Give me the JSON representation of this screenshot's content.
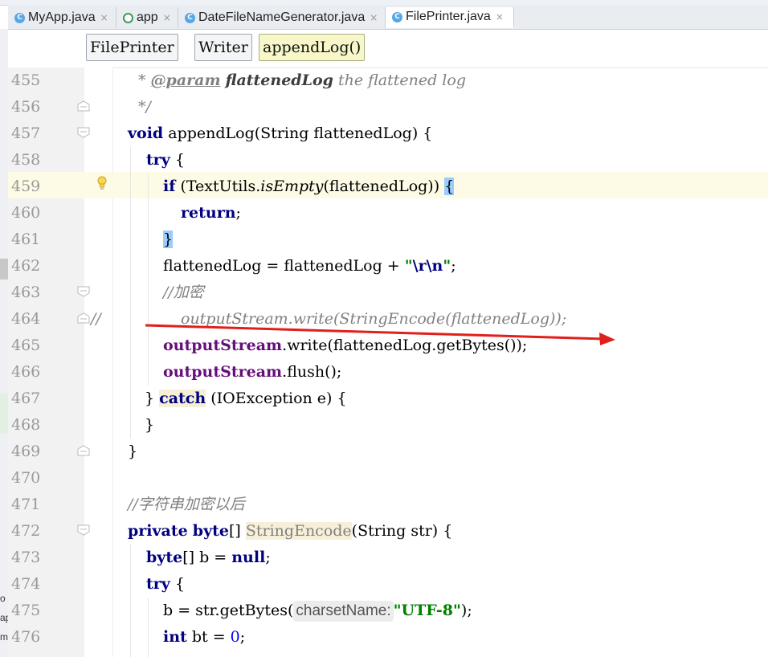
{
  "tabs": [
    {
      "label": "MyApp.java",
      "icon": "class-icon",
      "active": false
    },
    {
      "label": "app",
      "icon": "module-icon",
      "active": false
    },
    {
      "label": "DateFileNameGenerator.java",
      "icon": "class-icon",
      "active": false
    },
    {
      "label": "FilePrinter.java",
      "icon": "class-icon",
      "active": true
    }
  ],
  "tab_close_glyph": "×",
  "tab_icon_letter": "C",
  "breadcrumbs": [
    "FilePrinter",
    "Writer",
    "appendLog()"
  ],
  "side_panel_text": [
    "o",
    "ap",
    "m"
  ],
  "gutter": {
    "line_numbers": [
      "455",
      "456",
      "457",
      "458",
      "459",
      "460",
      "461",
      "462",
      "463",
      "464",
      "465",
      "466",
      "467",
      "468",
      "469",
      "470",
      "471",
      "472",
      "473",
      "474",
      "475",
      "476"
    ]
  },
  "code": {
    "l455": {
      "star": "* ",
      "tag": "@param",
      "name": "flattenedLog",
      "desc": " the flattened log"
    },
    "l456": {
      "text": "*/"
    },
    "l457": {
      "kw": "void",
      "rest": " appendLog(String flattenedLog) {"
    },
    "l458": {
      "kw": "try",
      "rest": " {"
    },
    "l459": {
      "kw": "if",
      "a": " (TextUtils.",
      "m": "isEmpty",
      "b": "(flattenedLog)) ",
      "brace": "{"
    },
    "l460": {
      "kw": "return",
      "rest": ";"
    },
    "l461": {
      "brace": "}"
    },
    "l462": {
      "a": "flattenedLog = flattenedLog + ",
      "q1": "\"",
      "esc": "\\r\\n",
      "q2": "\"",
      "b": ";"
    },
    "l463": {
      "text": "//加密"
    },
    "l464": {
      "prefix": "//",
      "text": "outputStream.write(StringEncode(flattenedLog));"
    },
    "l465": {
      "fld": "outputStream",
      "rest": ".write(flattenedLog.getBytes());"
    },
    "l466": {
      "fld": "outputStream",
      "rest": ".flush();"
    },
    "l467": {
      "a": "} ",
      "kw": "catch",
      "b": " (IOException e) {"
    },
    "l468": {
      "text": "}"
    },
    "l469": {
      "text": "}"
    },
    "l471": {
      "text": "//字符串加密以后"
    },
    "l472": {
      "kw1": "private",
      "kw2": "byte",
      "a": "[] ",
      "fn": "StringEncode",
      "b": "(String str) {"
    },
    "l473": {
      "kw1": "byte",
      "a": "[] b = ",
      "kw2": "null",
      "b": ";"
    },
    "l474": {
      "kw": "try",
      "rest": " {"
    },
    "l475": {
      "a": "b = str.getBytes(",
      "hint": "charsetName:",
      "str": "\"UTF-8\"",
      "b": ");"
    },
    "l476": {
      "kw": "int",
      "a": " bt = ",
      "num": "0",
      "b": ";"
    }
  },
  "colors": {
    "keyword": "#000080",
    "comment": "#808080",
    "field": "#660e7a",
    "string": "#008000",
    "number": "#0000ff",
    "annotation_arrow": "#e0201b",
    "current_line": "#fdfbe5",
    "brace_highlight": "#99ccff"
  }
}
